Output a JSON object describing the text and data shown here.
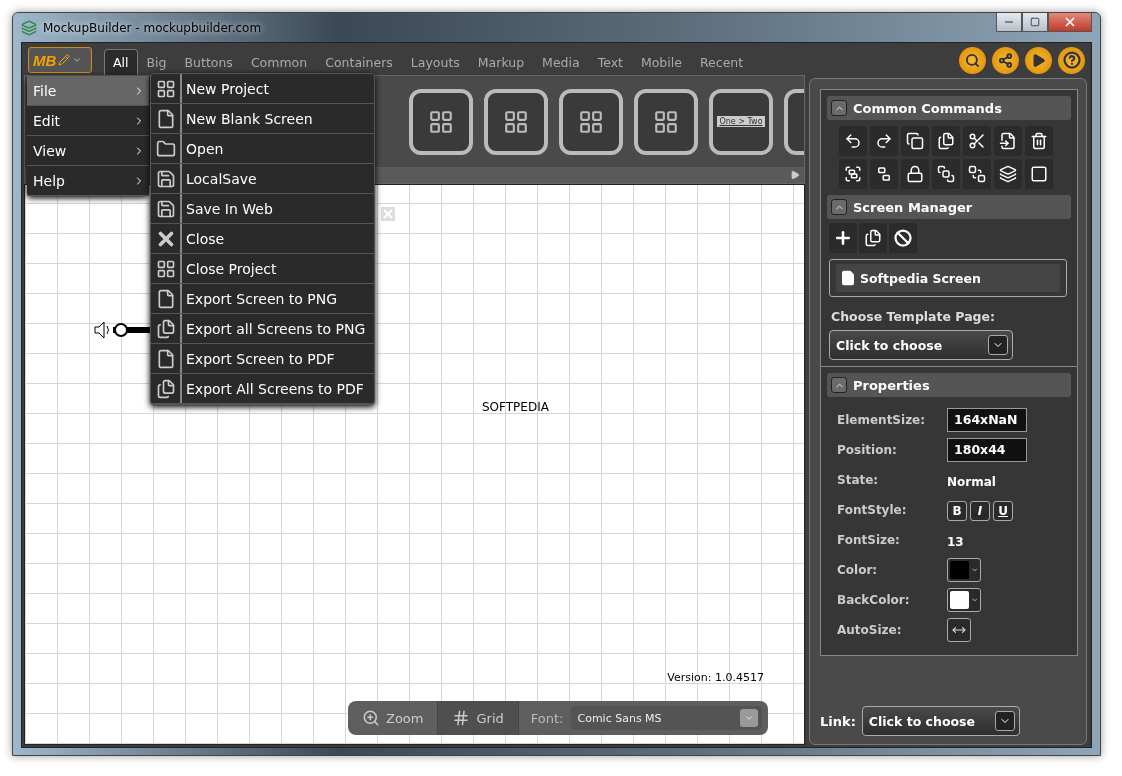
{
  "window": {
    "title": "MockupBuilder - mockupbuilder.com"
  },
  "logo": "MB",
  "tabs": [
    {
      "label": "All",
      "selected": true
    },
    {
      "label": "Big",
      "selected": false
    },
    {
      "label": "Buttons",
      "selected": false
    },
    {
      "label": "Common",
      "selected": false
    },
    {
      "label": "Containers",
      "selected": false
    },
    {
      "label": "Layouts",
      "selected": false
    },
    {
      "label": "Markup",
      "selected": false
    },
    {
      "label": "Media",
      "selected": false
    },
    {
      "label": "Text",
      "selected": false
    },
    {
      "label": "Mobile",
      "selected": false
    },
    {
      "label": "Recent",
      "selected": false
    }
  ],
  "main_menu": [
    {
      "label": "File",
      "selected": true
    },
    {
      "label": "Edit",
      "selected": false
    },
    {
      "label": "View",
      "selected": false
    },
    {
      "label": "Help",
      "selected": false
    }
  ],
  "file_menu": [
    {
      "label": "New Project",
      "kind": "project"
    },
    {
      "label": "New Blank Screen",
      "kind": "page"
    },
    {
      "label": "Open",
      "kind": "folder"
    },
    {
      "label": "LocalSave",
      "kind": "disk"
    },
    {
      "label": "Save In Web",
      "kind": "disk"
    },
    {
      "label": "Close",
      "kind": "close"
    },
    {
      "label": "Close Project",
      "kind": "project"
    },
    {
      "label": "Export Screen to PNG",
      "kind": "page"
    },
    {
      "label": "Export all Screens to PNG",
      "kind": "pages"
    },
    {
      "label": "Export Screen to PDF",
      "kind": "page"
    },
    {
      "label": "Export All Screens to PDF",
      "kind": "pages"
    }
  ],
  "palette": {
    "breadcrumb_preview": "One > Two"
  },
  "canvas": {
    "label": "SOFTPEDIA",
    "version": "Version: 1.0.4517"
  },
  "bottom_toolbar": {
    "zoom": "Zoom",
    "grid": "Grid",
    "font_label": "Font:",
    "font_value": "Comic Sans MS"
  },
  "common_commands": {
    "title": "Common Commands"
  },
  "screen_manager": {
    "title": "Screen Manager",
    "screens": [
      {
        "name": "Softpedia Screen",
        "selected": true
      }
    ],
    "template_label": "Choose Template Page:",
    "template_value": "Click to choose"
  },
  "properties": {
    "title": "Properties",
    "rows": [
      {
        "label": "ElementSize:",
        "kind": "field",
        "value": "164xNaN"
      },
      {
        "label": "Position:",
        "kind": "field",
        "value": "180x44"
      },
      {
        "label": "State:",
        "kind": "text",
        "value": "Normal"
      },
      {
        "label": "FontStyle:",
        "kind": "styles",
        "buttons": [
          "B",
          "I",
          "U"
        ]
      },
      {
        "label": "FontSize:",
        "kind": "text",
        "value": "13"
      },
      {
        "label": "Color:",
        "kind": "color",
        "color": "#000000"
      },
      {
        "label": "BackColor:",
        "kind": "color",
        "color": "#ffffff"
      },
      {
        "label": "AutoSize:",
        "kind": "autosize"
      }
    ]
  },
  "link": {
    "label": "Link:",
    "value": "Click to choose"
  }
}
